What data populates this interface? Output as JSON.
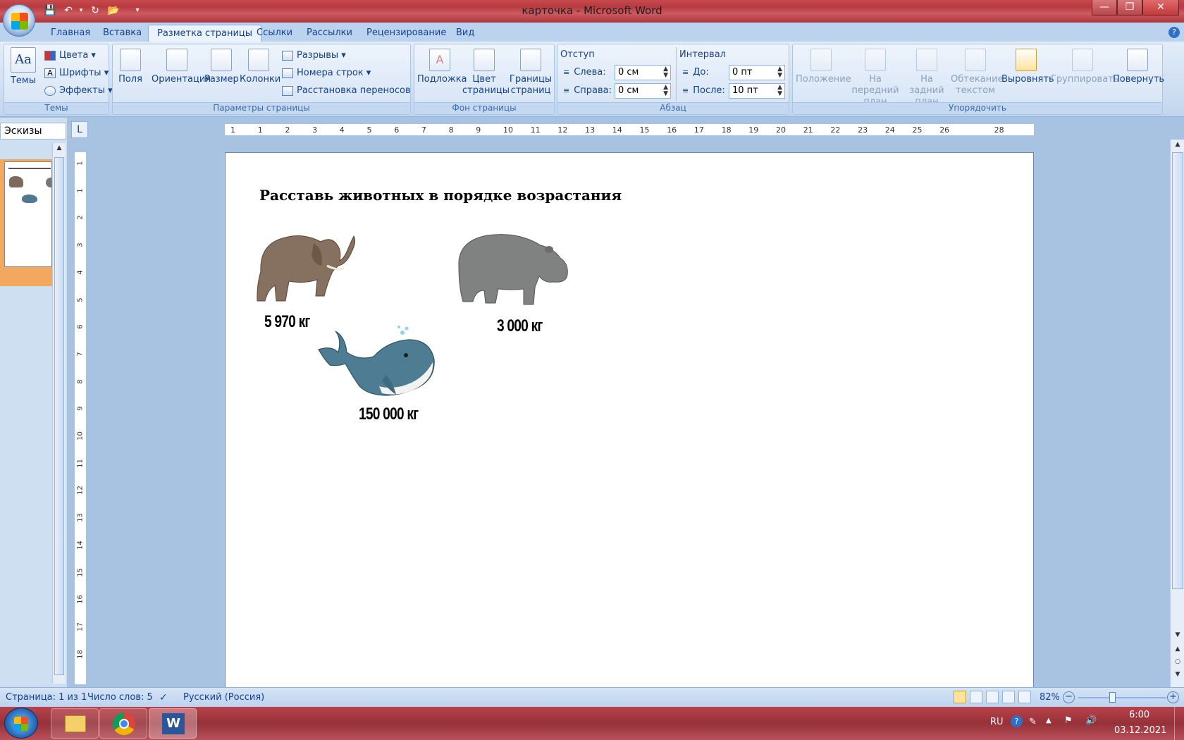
{
  "window": {
    "title": "карточка - Microsoft Word"
  },
  "quick_access": {
    "icons": [
      "save-icon",
      "undo-icon",
      "redo-icon",
      "open-icon",
      "customize-icon"
    ]
  },
  "tabs": [
    {
      "label": "Главная",
      "active": false
    },
    {
      "label": "Вставка",
      "active": false
    },
    {
      "label": "Разметка страницы",
      "active": true
    },
    {
      "label": "Ссылки",
      "active": false
    },
    {
      "label": "Рассылки",
      "active": false
    },
    {
      "label": "Рецензирование",
      "active": false
    },
    {
      "label": "Вид",
      "active": false
    }
  ],
  "ribbon": {
    "themes": {
      "label": "Темы",
      "themes_btn": "Темы",
      "colors": "Цвета",
      "fonts": "Шрифты",
      "effects": "Эффекты"
    },
    "page_setup": {
      "label": "Параметры страницы",
      "margins": "Поля",
      "orientation": "Ориентация",
      "size": "Размер",
      "columns": "Колонки",
      "breaks": "Разрывы",
      "line_numbers": "Номера строк",
      "hyphenation": "Расстановка переносов"
    },
    "background": {
      "label": "Фон страницы",
      "watermark": "Подложка",
      "page_color": "Цвет страницы",
      "page_borders": "Границы страниц"
    },
    "paragraph": {
      "label": "Абзац",
      "indent": "Отступ",
      "left": "Слева:",
      "left_val": "0 см",
      "right": "Справа:",
      "right_val": "0 см",
      "spacing": "Интервал",
      "before": "До:",
      "before_val": "0 пт",
      "after": "После:",
      "after_val": "10 пт"
    },
    "arrange": {
      "label": "Упорядочить",
      "position": "Положение",
      "bring_front": "На передний план",
      "send_back": "На задний план",
      "wrap": "Обтекание текстом",
      "align": "Выровнять",
      "group": "Группировать",
      "rotate": "Повернуть"
    }
  },
  "thumbs_pane": {
    "header": "Эскизы"
  },
  "ruler": {
    "h_ticks": [
      "1",
      "1",
      "2",
      "3",
      "4",
      "5",
      "6",
      "7",
      "8",
      "9",
      "10",
      "11",
      "12",
      "13",
      "14",
      "15",
      "16",
      "17",
      "18",
      "19",
      "20",
      "21",
      "22",
      "23",
      "24",
      "25",
      "26",
      "28"
    ],
    "v_ticks": [
      "1",
      "1",
      "2",
      "3",
      "4",
      "5",
      "6",
      "7",
      "8",
      "9",
      "10",
      "11",
      "12",
      "13",
      "14",
      "15",
      "16",
      "17",
      "18"
    ]
  },
  "document": {
    "title": "Расставь животных в  порядке возрастания",
    "items": [
      {
        "animal": "elephant",
        "weight": "5 970 кг"
      },
      {
        "animal": "hippo",
        "weight": "3 000 кг"
      },
      {
        "animal": "whale",
        "weight": "150 000 кг"
      }
    ]
  },
  "status": {
    "page": "Страница: 1 из 1",
    "words": "Число слов: 5",
    "language": "Русский (Россия)",
    "zoom": "82%"
  },
  "taskbar": {
    "lang": "RU",
    "time": "6:00",
    "date": "03.12.2021"
  }
}
